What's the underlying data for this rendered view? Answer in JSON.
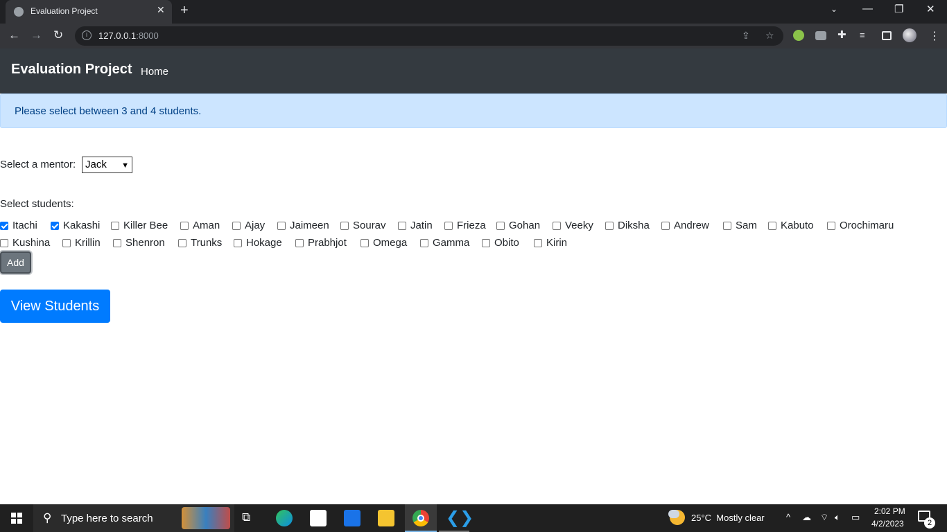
{
  "browser": {
    "tab_title": "Evaluation Project",
    "url_host": "127.0.0.1",
    "url_port": ":8000"
  },
  "navbar": {
    "brand": "Evaluation Project",
    "home": "Home"
  },
  "alert": {
    "message": "Please select between 3 and 4 students."
  },
  "form": {
    "mentor_label": "Select a mentor:",
    "mentor_selected": "Jack",
    "students_label": "Select students:",
    "students_row1": [
      {
        "name": "Itachi",
        "checked": true
      },
      {
        "name": "Kakashi",
        "checked": true
      },
      {
        "name": "Killer Bee",
        "checked": false
      },
      {
        "name": "Aman",
        "checked": false
      },
      {
        "name": "Ajay",
        "checked": false
      },
      {
        "name": "Jaimeen",
        "checked": false
      },
      {
        "name": "Sourav",
        "checked": false
      },
      {
        "name": "Jatin",
        "checked": false
      },
      {
        "name": "Frieza",
        "checked": false
      },
      {
        "name": "Gohan",
        "checked": false
      },
      {
        "name": "Veeky",
        "checked": false
      },
      {
        "name": "Diksha",
        "checked": false
      },
      {
        "name": "Andrew",
        "checked": false
      },
      {
        "name": "Sam",
        "checked": false
      },
      {
        "name": "Kabuto",
        "checked": false
      },
      {
        "name": "Orochimaru",
        "checked": false
      }
    ],
    "students_row2": [
      {
        "name": "Kushina",
        "checked": false
      },
      {
        "name": "Krillin",
        "checked": false
      },
      {
        "name": "Shenron",
        "checked": false
      },
      {
        "name": "Trunks",
        "checked": false
      },
      {
        "name": "Hokage",
        "checked": false
      },
      {
        "name": "Prabhjot",
        "checked": false
      },
      {
        "name": "Omega",
        "checked": false
      },
      {
        "name": "Gamma",
        "checked": false
      },
      {
        "name": "Obito",
        "checked": false
      },
      {
        "name": "Kirin",
        "checked": false
      }
    ],
    "add_label": "Add",
    "view_label": "View Students"
  },
  "taskbar": {
    "search_placeholder": "Type here to search",
    "weather_temp": "25°C",
    "weather_desc": "Mostly clear",
    "time": "2:02 PM",
    "date": "4/2/2023",
    "notifications": "2"
  },
  "colors": {
    "navbar_bg": "#343a40",
    "alert_bg": "#cce5ff",
    "primary": "#007bff",
    "secondary": "#6c757d",
    "checkbox_checked": "#0075ff"
  }
}
